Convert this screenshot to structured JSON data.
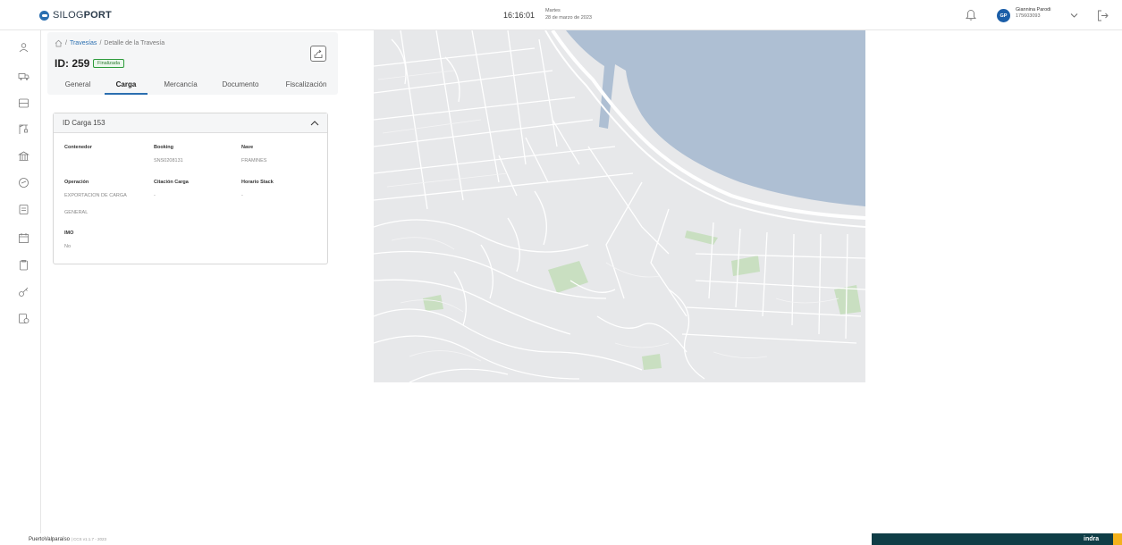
{
  "header": {
    "brand_prefix": "SILOG",
    "brand_suffix": "PORT",
    "clock": "16:16:01",
    "weekday": "Martes",
    "date": "28 de marzo de 2023",
    "user_initials": "GP",
    "user_name": "Giannina Parodi",
    "user_id": "175603093"
  },
  "breadcrumb": {
    "link": "Travesías",
    "separator": "/",
    "current": "Detalle de la Travesía"
  },
  "detail": {
    "id_label": "ID: 259",
    "status": "Finalizada"
  },
  "tabs": [
    {
      "label": "General"
    },
    {
      "label": "Carga"
    },
    {
      "label": "Mercancía"
    },
    {
      "label": "Documento"
    },
    {
      "label": "Fiscalización"
    }
  ],
  "card": {
    "title": "ID Carga 153",
    "fields": {
      "contenedor": {
        "label": "Contenedor",
        "value": ""
      },
      "booking": {
        "label": "Booking",
        "value": "SNS0208131"
      },
      "nave": {
        "label": "Nave",
        "value": "FRAMINES"
      },
      "operacion": {
        "label": "Operación",
        "value_line1": "EXPORTACION DE CARGA",
        "value_line2": "GENERAL"
      },
      "citacion": {
        "label": "Citación Carga",
        "value": "-"
      },
      "horario": {
        "label": "Horario Stack",
        "value": "-"
      },
      "imo": {
        "label": "IMO",
        "value": "No"
      }
    }
  },
  "footer": {
    "place": "PuertoValparaíso",
    "version": "| CCS v1.1.7 - 2023",
    "brand": "indra"
  },
  "colors": {
    "accent": "#2b6fb0",
    "status_green": "#2e9b3c",
    "map_land": "#e7e8ea",
    "map_water": "#aebfd3",
    "map_park": "#c9dfc1",
    "footer_bar": "#0f3d46",
    "footer_accent": "#f3b21d"
  }
}
